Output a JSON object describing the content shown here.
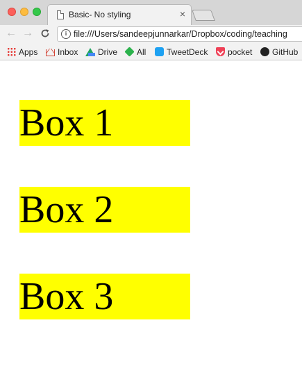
{
  "browser": {
    "tab_title": "Basic- No styling",
    "tab_close": "×",
    "url": "file:///Users/sandeepjunnarkar/Dropbox/coding/teaching",
    "nav": {
      "back": "←",
      "forward": "→",
      "reload": "C"
    },
    "info_glyph": "i"
  },
  "bookmarks": [
    {
      "label": "Apps",
      "icon": "apps-icon"
    },
    {
      "label": "Inbox",
      "icon": "gmail-icon"
    },
    {
      "label": "Drive",
      "icon": "drive-icon"
    },
    {
      "label": "All",
      "icon": "feedly-icon"
    },
    {
      "label": "TweetDeck",
      "icon": "tweetdeck-icon"
    },
    {
      "label": "pocket",
      "icon": "pocket-icon"
    },
    {
      "label": "GitHub",
      "icon": "github-icon"
    }
  ],
  "page": {
    "boxes": [
      {
        "label": "Box 1"
      },
      {
        "label": "Box 2"
      },
      {
        "label": "Box 3"
      }
    ]
  },
  "colors": {
    "box_background": "#ffff00",
    "box_text": "#000000",
    "page_background": "#ffffff"
  }
}
